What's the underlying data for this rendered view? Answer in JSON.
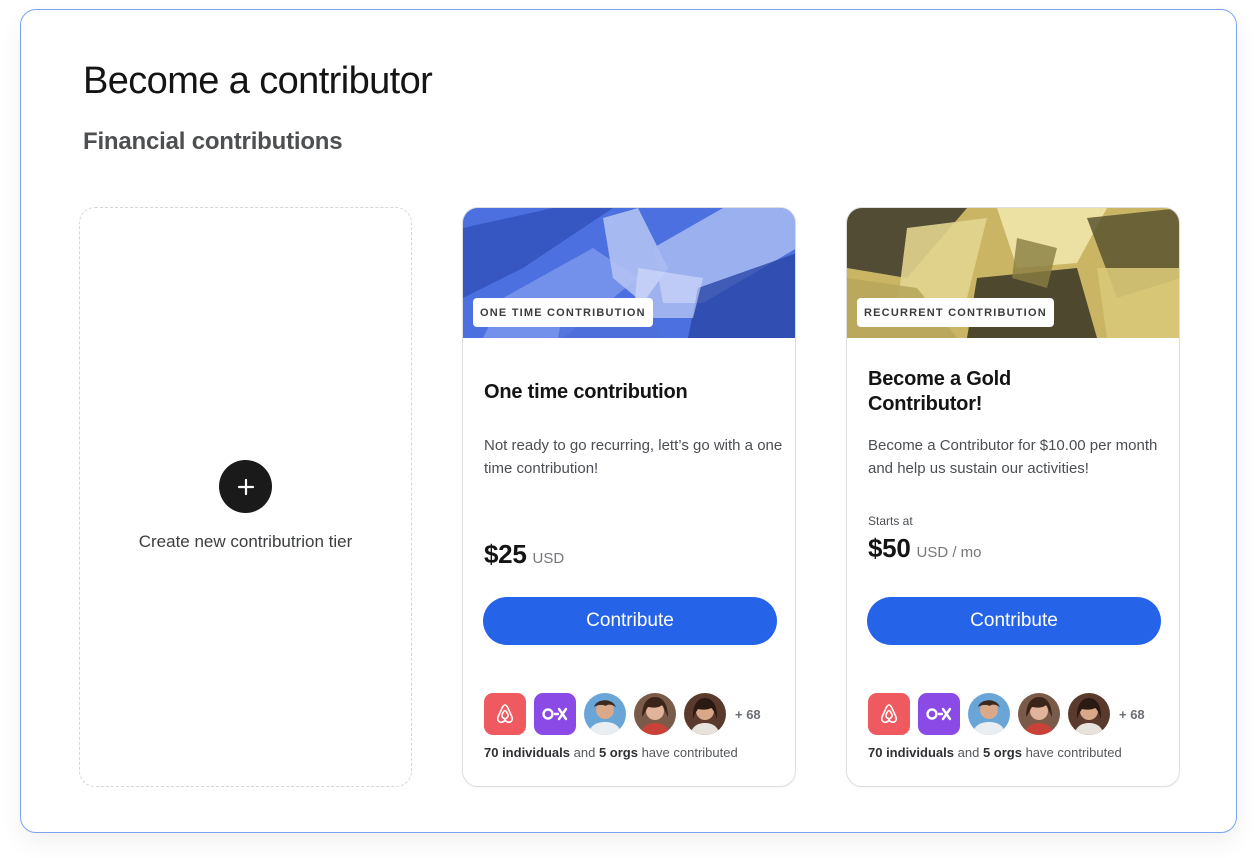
{
  "page": {
    "title": "Become a contributor",
    "section_title": "Financial contributions"
  },
  "create_tier": {
    "icon": "plus-icon",
    "label": "Create new contributrion tier"
  },
  "tiers": [
    {
      "cover_tag": "ONE TIME CONTRIBUTION",
      "cover_tint": "#4a6fe0",
      "title": "One time contribution",
      "description": "Not ready to go recurring, lett’s go with a one time contribution!",
      "starts_at": "",
      "price": "$25",
      "price_unit": "USD",
      "button_label": "Contribute",
      "more_count": "+ 68",
      "individuals": "70 individuals",
      "and_text": "and",
      "orgs": "5 orgs",
      "contributed_text": "have contributed"
    },
    {
      "cover_tag": "RECURRENT CONTRIBUTION",
      "cover_tint": "#d9c46a",
      "title": "Become a Gold Contributor!",
      "description": "Become a Contributor for $10.00 per month and help us sustain our activities!",
      "starts_at": "Starts at",
      "price": "$50",
      "price_unit": "USD / mo",
      "button_label": "Contribute",
      "more_count": "+ 68",
      "individuals": "70 individuals",
      "and_text": "and",
      "orgs": "5 orgs",
      "contributed_text": "have contributed"
    }
  ],
  "contributor_icons": [
    "airbnb-logo-icon",
    "ox-logo-icon",
    "person-avatar",
    "person-avatar",
    "person-avatar"
  ],
  "colors": {
    "accent": "#2563e8",
    "panel_border": "#7aa4f0",
    "airbnb": "#ef5a60",
    "ox": "#8b4ae6"
  }
}
